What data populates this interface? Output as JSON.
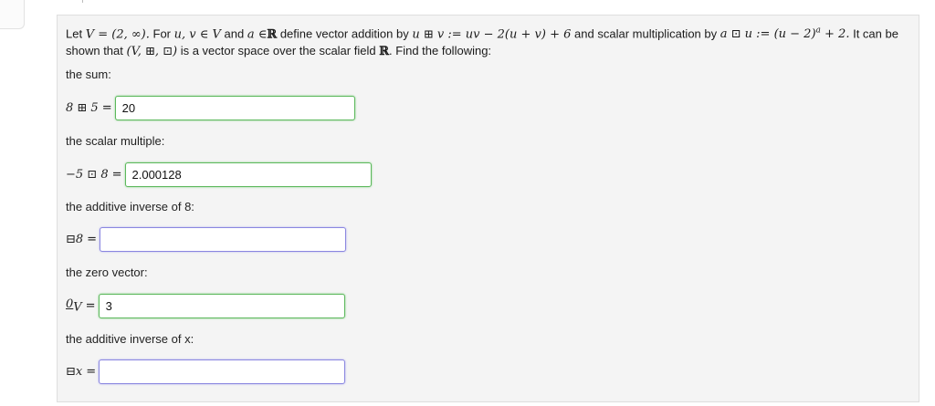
{
  "problem": {
    "intro": "Let",
    "set_def": "V = (2, ∞).",
    "for_text": "For",
    "vars": "u, v ∈ V",
    "and1": "and",
    "scalar_var": "a ∈",
    "reals": "ℝ",
    "def_add": "define vector addition by",
    "add_formula": "u ⊞ v := uv − 2(u + v) + 6",
    "and2": "and",
    "def_mul": "scalar multiplication by",
    "mul_formula_base": "a ⊡ u := (u − 2)",
    "mul_formula_exp": "a",
    "mul_formula_tail": "+ 2.",
    "tail1": "It can be shown that",
    "tuple": "(V, ⊞, ⊡)",
    "tail2": "is a vector space over the scalar field",
    "tail3": ". Find the following:"
  },
  "questions": [
    {
      "label": "the sum:",
      "expr": "8 ⊞ 5",
      "value": "20",
      "state": "correct"
    },
    {
      "label": "the scalar multiple:",
      "expr": "−5 ⊡ 8",
      "value": "2.000128",
      "state": "correct"
    },
    {
      "label": "the additive inverse of 8:",
      "expr": "⊟8",
      "value": "",
      "state": "empty"
    },
    {
      "label": "the zero vector:",
      "expr_base": "0",
      "expr_sub": "V",
      "value": "3",
      "state": "correct"
    },
    {
      "label": "the additive inverse of x:",
      "expr": "⊟x",
      "value": "",
      "state": "empty"
    }
  ],
  "equals": "=",
  "colors": {
    "correct": "#5cb85c",
    "empty": "#8a86e0",
    "panel": "#f4f4f4"
  }
}
